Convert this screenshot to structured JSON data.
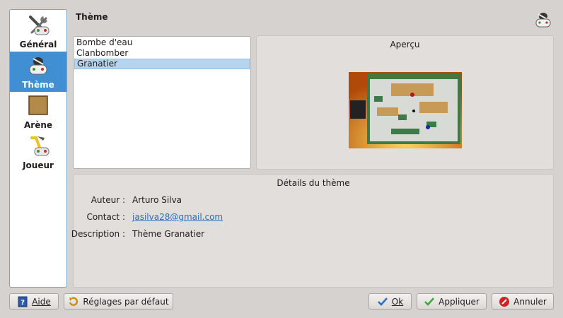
{
  "sidebar": {
    "items": [
      {
        "label": "Général",
        "icon": "general-settings-icon"
      },
      {
        "label": "Thème",
        "icon": "theme-icon"
      },
      {
        "label": "Arène",
        "icon": "arena-icon"
      },
      {
        "label": "Joueur",
        "icon": "player-icon"
      }
    ],
    "active_index": 1
  },
  "header": {
    "title": "Thème"
  },
  "themes": {
    "items": [
      "Bombe d'eau",
      "Clanbomber",
      "Granatier"
    ],
    "selected": "Granatier"
  },
  "preview": {
    "title": "Aperçu"
  },
  "details": {
    "title": "Détails du thème",
    "author_label": "Auteur :",
    "author": "Arturo Silva",
    "contact_label": "Contact :",
    "contact": "jasilva28@gmail.com",
    "description_label": "Description :",
    "description": "Thème Granatier"
  },
  "buttons": {
    "help": "Aide",
    "defaults": "Réglages par défaut",
    "ok": "Ok",
    "apply": "Appliquer",
    "cancel": "Annuler"
  },
  "colors": {
    "accent": "#3f8fd2",
    "selection": "#b6d4ee",
    "link": "#2a6fbf"
  }
}
